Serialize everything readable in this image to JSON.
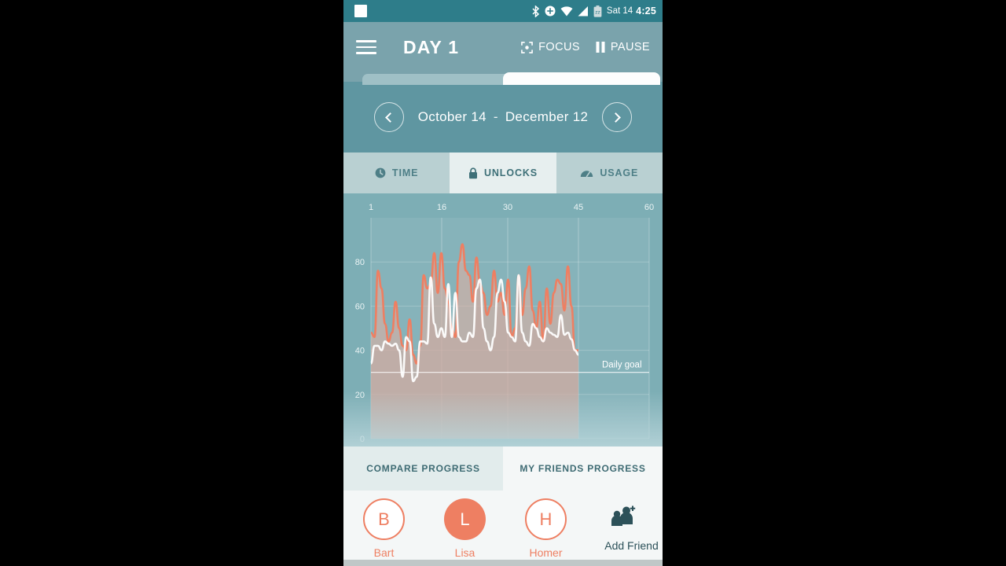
{
  "statusbar": {
    "time": "4:25",
    "day": "Sat 14",
    "icons": [
      "bluetooth-icon",
      "location-icon",
      "wifi-icon",
      "signal-icon",
      "battery-icon"
    ]
  },
  "appbar": {
    "title": "DAY 1",
    "menu_icon": "hamburger-icon",
    "focus_label": "FOCUS",
    "pause_label": "PAUSE"
  },
  "datenav": {
    "start": "October 14",
    "separator": "-",
    "end": "December 12",
    "prev_icon": "chevron-left-icon",
    "next_icon": "chevron-right-icon"
  },
  "tabs": [
    {
      "label": "TIME",
      "icon": "clock-icon",
      "active": false
    },
    {
      "label": "UNLOCKS",
      "icon": "lock-icon",
      "active": true
    },
    {
      "label": "USAGE",
      "icon": "speedometer-icon",
      "active": false
    }
  ],
  "bottom_tabs": [
    {
      "label": "COMPARE PROGRESS",
      "active": true
    },
    {
      "label": "MY FRIENDS PROGRESS",
      "active": false
    }
  ],
  "friends": [
    {
      "name": "Bart",
      "initial": "B",
      "style": "outline"
    },
    {
      "name": "Lisa",
      "initial": "L",
      "style": "filled"
    },
    {
      "name": "Homer",
      "initial": "H",
      "style": "outline"
    }
  ],
  "add_friend": {
    "label": "Add Friend",
    "icon": "add-people-icon"
  },
  "colors": {
    "statusbar": "#2E7D8A",
    "appbar": "#7AA3AC",
    "datenav": "#5F96A1",
    "chart_bg": "#7DAEB5",
    "accent": "#EE7F62",
    "tab_active_bg": "#E7EFEF",
    "bottom_bg": "#F4F7F7"
  },
  "chart_data": {
    "type": "area",
    "title": "",
    "xlabel": "",
    "ylabel": "",
    "xlim": [
      1,
      60
    ],
    "ylim": [
      0,
      100
    ],
    "xticks": [
      1,
      16,
      30,
      45,
      60
    ],
    "yticks": [
      0,
      20,
      40,
      60,
      80
    ],
    "grid": true,
    "legend": "none",
    "annotations": [
      {
        "text": "Daily goal",
        "y": 30,
        "type": "hline"
      }
    ],
    "series": [
      {
        "name": "me",
        "color": "#EE7F62",
        "fill": true,
        "values": [
          48,
          46,
          76,
          68,
          52,
          44,
          48,
          62,
          50,
          42,
          40,
          54,
          38,
          34,
          42,
          74,
          68,
          70,
          84,
          66,
          84,
          68,
          62,
          50,
          46,
          80,
          88,
          76,
          74,
          62,
          82,
          70,
          66,
          56,
          60,
          76,
          62,
          66,
          56,
          72,
          46,
          50,
          74,
          56,
          68,
          78,
          58,
          50,
          62,
          44,
          68,
          52,
          66,
          72,
          70,
          58,
          78,
          60,
          40,
          40
        ]
      },
      {
        "name": "friend-white",
        "color": "#FFFFFF",
        "fill": false,
        "values": [
          34,
          42,
          42,
          40,
          44,
          43,
          42,
          43,
          40,
          28,
          46,
          44,
          26,
          28,
          44,
          44,
          43,
          73,
          52,
          46,
          50,
          46,
          70,
          46,
          66,
          46,
          44,
          44,
          48,
          46,
          68,
          72,
          50,
          44,
          40,
          46,
          66,
          72,
          62,
          48,
          46,
          44,
          74,
          48,
          44,
          42,
          52,
          50,
          46,
          44,
          50,
          48,
          47,
          46,
          56,
          47,
          48,
          45,
          40,
          38
        ]
      }
    ]
  }
}
